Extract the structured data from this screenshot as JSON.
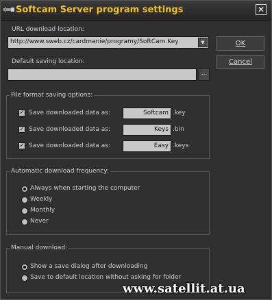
{
  "window": {
    "title": "Softcam Server program settings",
    "close_icon": "close-icon"
  },
  "url": {
    "label": "URL download location:",
    "value": "http://www.sweb.cz/cardmanie/programy/SoftCam.Key"
  },
  "saving_location": {
    "label": "Default saving location:",
    "value": "",
    "browse_label": "..."
  },
  "buttons": {
    "ok": "OK",
    "cancel": "Cancel"
  },
  "file_format": {
    "title": "File format saving options:",
    "rows": [
      {
        "label": "Save downloaded data as:",
        "checked": true,
        "name": "Softcam",
        "ext": ".key"
      },
      {
        "label": "Save downloaded data as:",
        "checked": true,
        "name": "Keys",
        "ext": ".bin"
      },
      {
        "label": "Save downloaded data as:",
        "checked": true,
        "name": "Easy",
        "ext": ".keys"
      }
    ]
  },
  "auto_download": {
    "title": "Automatic download frequency:",
    "options": [
      {
        "label": "Always when starting the computer",
        "selected": true
      },
      {
        "label": "Weekly",
        "selected": false
      },
      {
        "label": "Monthly",
        "selected": false
      },
      {
        "label": "Never",
        "selected": false
      }
    ]
  },
  "manual_download": {
    "title": "Manual download:",
    "options": [
      {
        "label": "Show a save dialog after downloading",
        "selected": true
      },
      {
        "label": "Save to default location without asking for folder",
        "selected": false
      }
    ]
  },
  "watermark": "www.satellit.at.ua",
  "colors": {
    "title_text": "#f0c020",
    "background": "#303030",
    "field": "#c8c8c8"
  }
}
